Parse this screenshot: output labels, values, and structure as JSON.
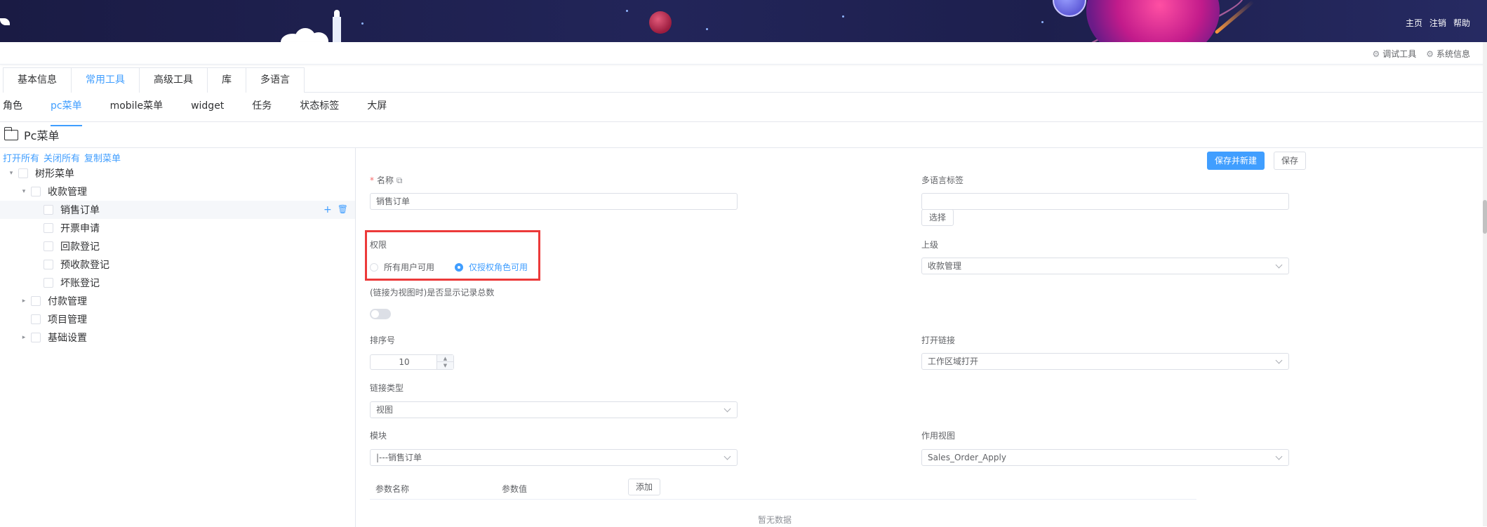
{
  "header": {
    "links": [
      "主页",
      "注销",
      "帮助"
    ]
  },
  "toolbar": {
    "debug_label": "调试工具",
    "sysinfo_label": "系统信息"
  },
  "main_tabs": [
    "基本信息",
    "常用工具",
    "高级工具",
    "库",
    "多语言"
  ],
  "main_tabs_active": "常用工具",
  "sub_tabs": [
    "角色",
    "pc菜单",
    "mobile菜单",
    "widget",
    "任务",
    "状态标签",
    "大屏"
  ],
  "sub_tabs_active": "pc菜单",
  "panel": {
    "title": "Pc菜单"
  },
  "tree": {
    "actions": [
      "打开所有",
      "关闭所有",
      "复制菜单"
    ],
    "nodes": [
      {
        "label": "树形菜单",
        "caret": "▾"
      },
      {
        "label": "收款管理",
        "caret": "▾"
      },
      {
        "label": "销售订单",
        "caret": ""
      },
      {
        "label": "开票申请",
        "caret": ""
      },
      {
        "label": "回款登记",
        "caret": ""
      },
      {
        "label": "预收款登记",
        "caret": ""
      },
      {
        "label": "坏账登记",
        "caret": ""
      },
      {
        "label": "付款管理",
        "caret": "▸"
      },
      {
        "label": "项目管理",
        "caret": ""
      },
      {
        "label": "基础设置",
        "caret": "▸"
      }
    ],
    "ops": {
      "add": "+",
      "delete": "🗑"
    }
  },
  "form": {
    "save_new_label": "保存并新建",
    "save_label": "保存",
    "name_label": "名称",
    "name_value": "销售订单",
    "i18n_label": "多语言标签",
    "i18n_value": "",
    "choose_label": "选择",
    "perm_label": "权限",
    "perm_options": [
      "所有用户可用",
      "仅授权角色可用"
    ],
    "perm_selected": "仅授权角色可用",
    "parent_label": "上级",
    "parent_value": "收款管理",
    "show_count_label": "(链接为视图时)是否显示记录总数",
    "show_count_on": false,
    "order_label": "排序号",
    "order_value": "10",
    "open_label": "打开链接",
    "open_value": "工作区域打开",
    "link_type_label": "链接类型",
    "link_type_value": "视图",
    "module_label": "模块",
    "module_value": "|---销售订单",
    "view_label": "作用视图",
    "view_value": "Sales_Order_Apply",
    "param_name_label": "参数名称",
    "param_value_label": "参数值",
    "add_label": "添加",
    "empty_text": "暂无数据"
  },
  "colors": {
    "accent": "#409eff",
    "highlight_box": "#ec3a3a",
    "banner": "#1f2150"
  }
}
